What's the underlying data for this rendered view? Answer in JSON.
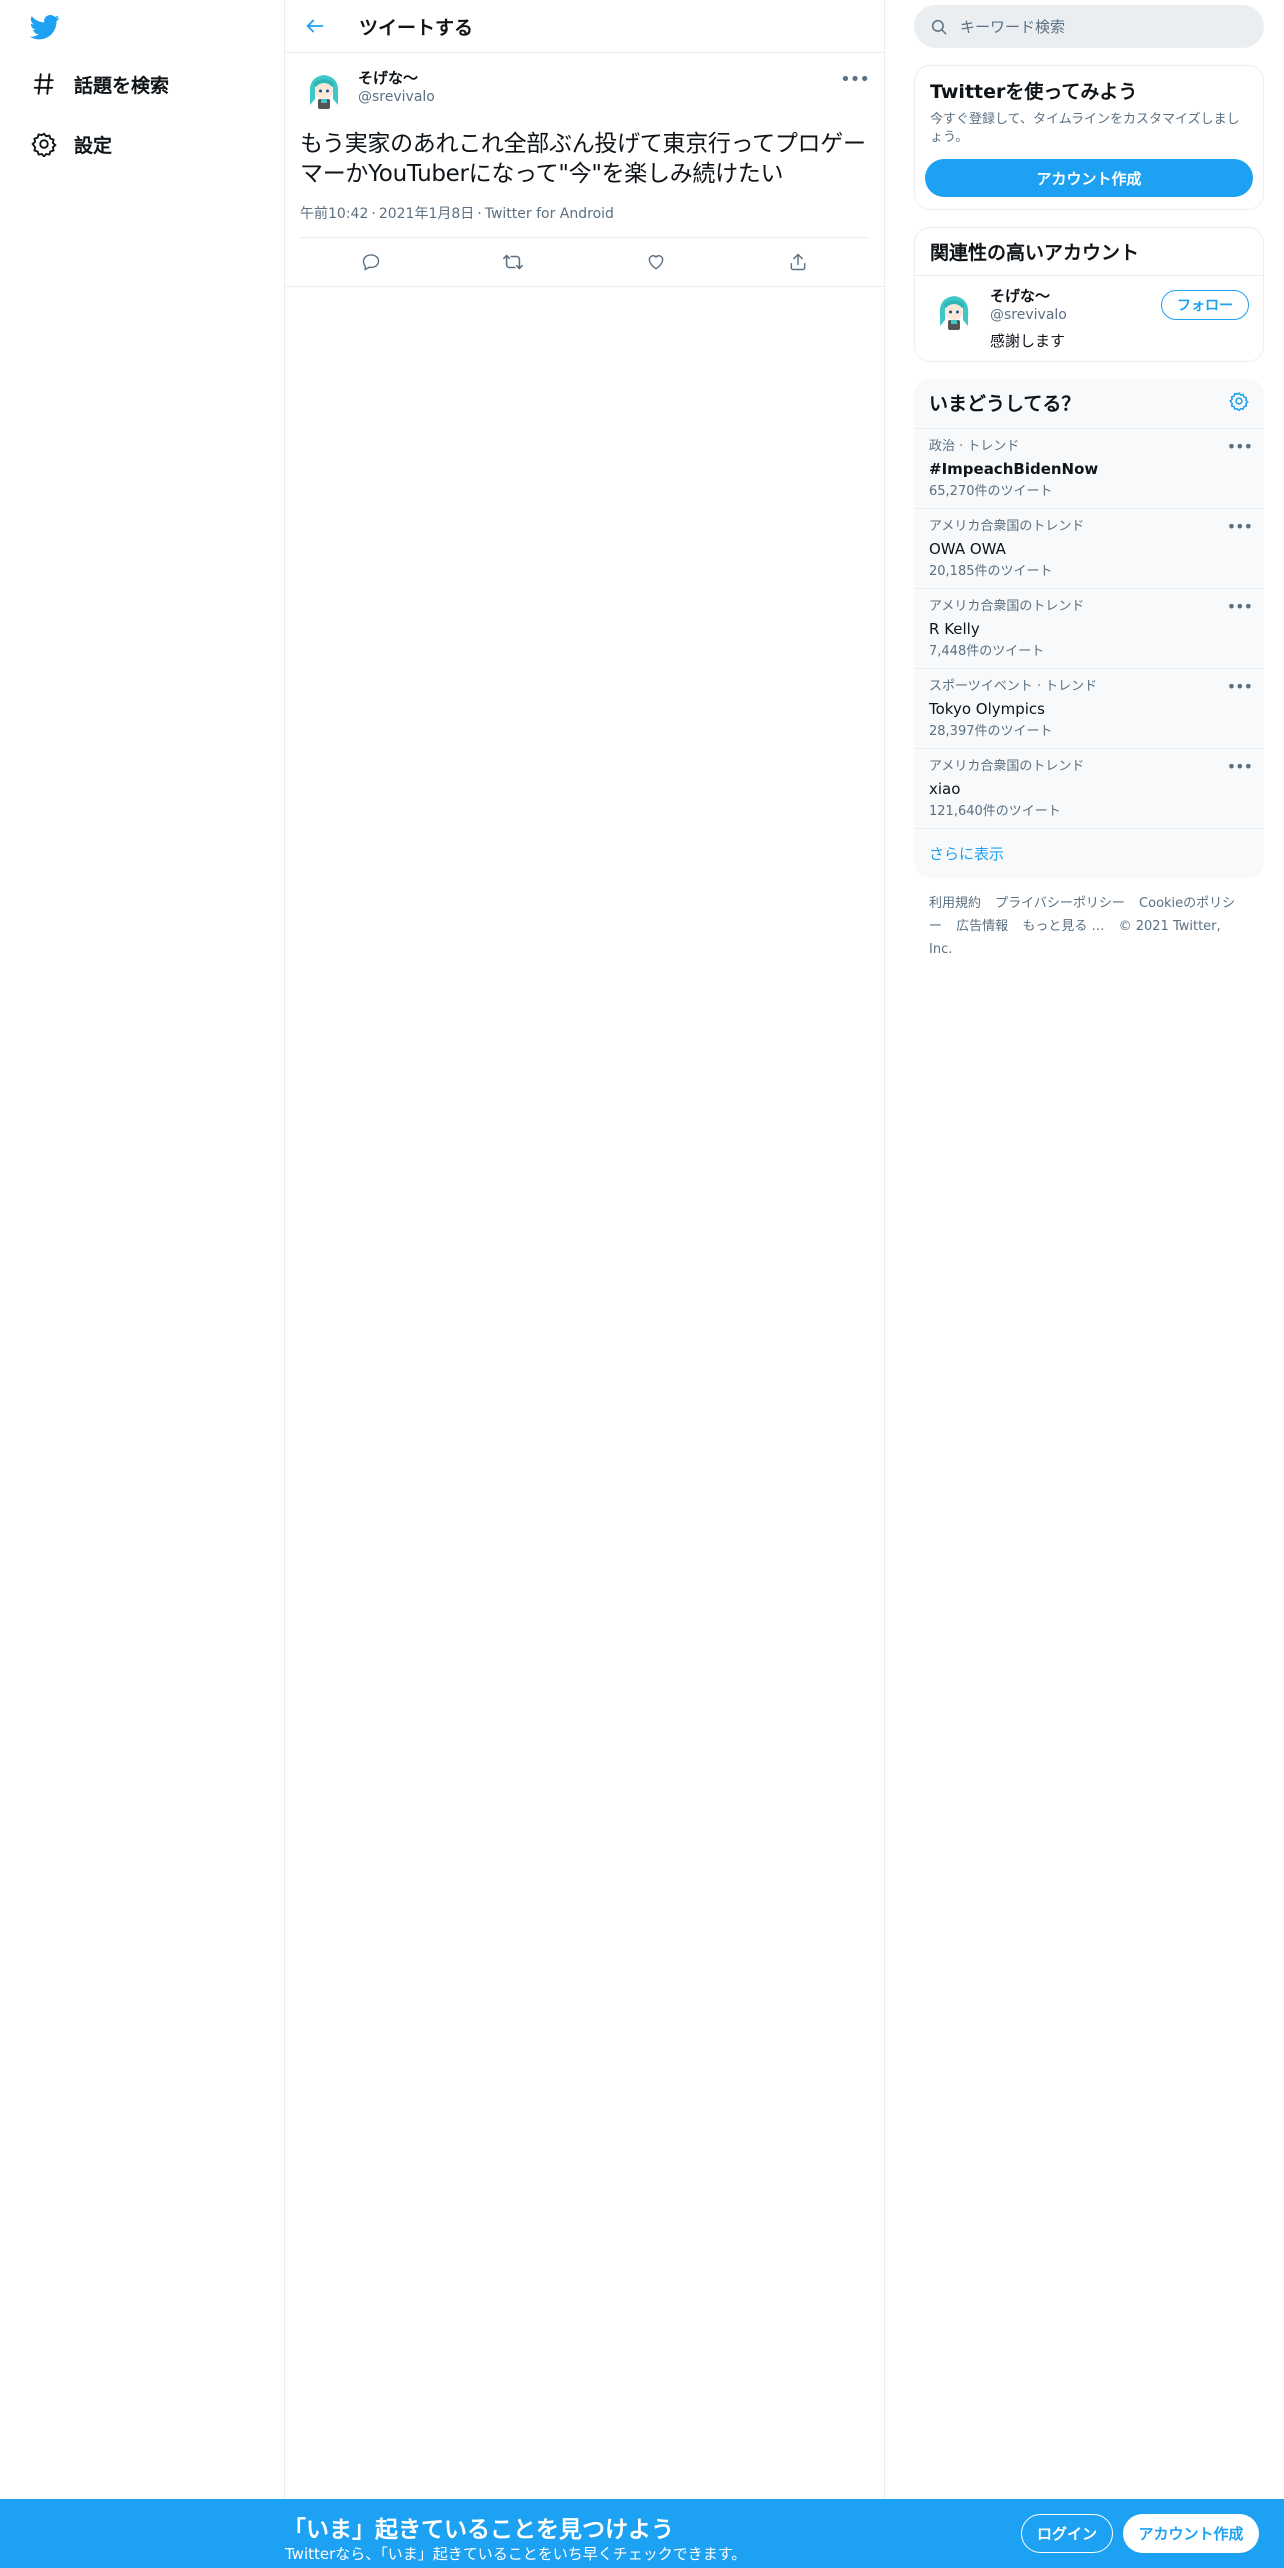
{
  "sidebar": {
    "logo_icon": "twitter-bird-icon",
    "items": [
      {
        "label": "話題を検索",
        "icon": "hashtag-icon"
      },
      {
        "label": "設定",
        "icon": "gear-icon"
      }
    ]
  },
  "header": {
    "title": "ツイートする",
    "back_icon": "arrow-left-icon"
  },
  "tweet": {
    "display_name": "そげな〜",
    "handle": "@srevivalo",
    "text": "もう実家のあれこれ全部ぶん投げて東京行ってプロゲーマーかYouTuberになって\"今\"を楽しみ続けたい",
    "time": "午前10:42",
    "date": "2021年1月8日",
    "source": "Twitter for Android",
    "separator": "·"
  },
  "search": {
    "placeholder": "キーワード検索"
  },
  "signup_box": {
    "title": "Twitterを使ってみよう",
    "desc": "今すぐ登録して、タイムラインをカスタマイズしましょう。",
    "button": "アカウント作成"
  },
  "related": {
    "title": "関連性の高いアカウント",
    "user": {
      "display_name": "そげな〜",
      "handle": "@srevivalo",
      "bio": "感謝します",
      "follow_label": "フォロー"
    }
  },
  "trends": {
    "title": "いまどうしてる？",
    "items": [
      {
        "context": "政治 · トレンド",
        "name": "#ImpeachBidenNow",
        "count": "65,270件のツイート"
      },
      {
        "context": "アメリカ合衆国のトレンド",
        "name": "OWA OWA",
        "count": "20,185件のツイート"
      },
      {
        "context": "アメリカ合衆国のトレンド",
        "name": "R Kelly",
        "count": "7,448件のツイート"
      },
      {
        "context": "スポーツイベント · トレンド",
        "name": "Tokyo Olympics",
        "count": "28,397件のツイート"
      },
      {
        "context": "アメリカ合衆国のトレンド",
        "name": "xiao",
        "count": "121,640件のツイート"
      }
    ],
    "show_more": "さらに表示"
  },
  "footer": {
    "links": [
      "利用規約",
      "プライバシーポリシー",
      "Cookieのポリシー",
      "広告情報",
      "もっと見る …"
    ],
    "copyright": "© 2021 Twitter, Inc."
  },
  "banner": {
    "title": "「いま」起きていることを見つけよう",
    "subtitle": "Twitterなら、「いま」起きていることをいち早くチェックできます。",
    "login": "ログイン",
    "signup": "アカウント作成"
  },
  "colors": {
    "accent": "#1da1f2",
    "text": "#0f1419",
    "muted": "#5b7083",
    "border": "#ebeef0",
    "panel": "#f7f9fa"
  }
}
